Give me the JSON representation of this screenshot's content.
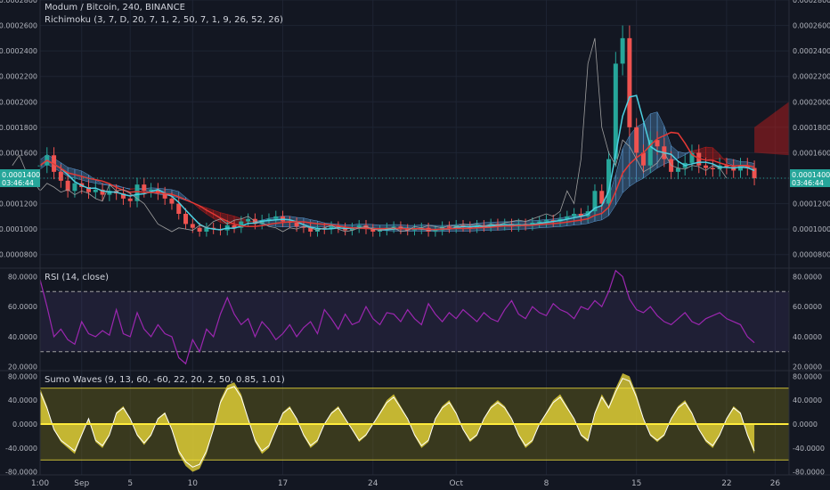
{
  "header": {
    "title": "Modum / Bitcoin, 240, BINANCE",
    "indicator": "Richimoku (3, 7, D, 20, 7, 1, 2, 50, 7, 1, 9, 26, 52, 26)"
  },
  "colors": {
    "background": "#131722",
    "grid": "#1e2433",
    "axis_text": "#b2b5be",
    "up_candle": "#26a69a",
    "down_candle": "#ef5350",
    "cloud_bull": "#5b9bd5",
    "cloud_bear": "#b71c1c",
    "rsi_line": "#9c27b0",
    "rsi_band": "#7e57c2",
    "sumo": "#ffeb3b",
    "price_badge": "#26a69a"
  },
  "price_badge": {
    "value": "0.0001400",
    "time": "03:46:44"
  },
  "chart_data": [
    {
      "type": "line",
      "panel": "price",
      "title": "Modum / Bitcoin, 240, BINANCE",
      "x_labels": [
        "1:00",
        "Sep",
        "5",
        "10",
        "17",
        "24",
        "Oct",
        "8",
        "15",
        "22",
        "26"
      ],
      "x_positions": [
        0,
        6,
        13,
        22,
        35,
        48,
        60,
        73,
        86,
        99,
        106
      ],
      "xlim": [
        0,
        108
      ],
      "yticks": [
        "0.0000800",
        "0.0001000",
        "0.0001200",
        "0.0001400",
        "0.0001600",
        "0.0001800",
        "0.0002000",
        "0.0002200",
        "0.0002400",
        "0.0002600",
        "0.0002800"
      ],
      "ylim": [
        7e-05,
        0.00028
      ],
      "close": [
        0.00015,
        0.000158,
        0.000145,
        0.000138,
        0.00013,
        0.000136,
        0.000133,
        0.000129,
        0.000131,
        0.000127,
        0.00013,
        0.000128,
        0.000124,
        0.000122,
        0.000135,
        0.00013,
        0.000131,
        0.000128,
        0.000124,
        0.00012,
        0.000112,
        0.000104,
        0.000101,
        9.8e-05,
        0.000101,
        0.0001,
        9.9e-05,
        0.000103,
        0.000101,
        0.000106,
        0.000108,
        0.000104,
        0.000107,
        0.000108,
        0.00011,
        0.000106,
        0.000105,
        0.000102,
        0.000101,
        9.8e-05,
        0.000101,
        0.0001,
        0.000102,
        0.000101,
        9.9e-05,
        0.000101,
        0.000103,
        0.0001,
        9.8e-05,
        9.9e-05,
        0.000101,
        0.000102,
        0.0001,
        9.9e-05,
        0.0001,
        0.000101,
        9.8e-05,
        9.9e-05,
        0.000102,
        0.000101,
        0.000103,
        0.000102,
        0.000101,
        0.000103,
        0.000102,
        0.000104,
        0.000103,
        0.000104,
        0.000102,
        0.000104,
        0.000103,
        0.000105,
        0.000106,
        0.000107,
        0.000106,
        0.000108,
        0.00011,
        0.000112,
        0.00011,
        0.000114,
        0.00013,
        0.00012,
        0.000155,
        0.00023,
        0.00025,
        0.00018,
        0.00016,
        0.00015,
        0.00017,
        0.000165,
        0.000155,
        0.000145,
        0.000148,
        0.000152,
        0.00016,
        0.00015,
        0.000148,
        0.000147,
        0.00015,
        0.000149,
        0.000146,
        0.00015,
        0.000148,
        0.00014
      ]
    },
    {
      "type": "line",
      "panel": "rsi",
      "title": "RSI (14, close)",
      "yticks": [
        "20.0000",
        "40.0000",
        "60.0000",
        "80.0000"
      ],
      "ylim": [
        18,
        85
      ],
      "bands": [
        30,
        70
      ],
      "values": [
        78,
        60,
        40,
        45,
        38,
        35,
        50,
        42,
        40,
        44,
        41,
        58,
        42,
        40,
        56,
        45,
        40,
        48,
        42,
        40,
        26,
        22,
        38,
        30,
        45,
        40,
        55,
        66,
        55,
        48,
        52,
        40,
        50,
        45,
        38,
        42,
        48,
        40,
        46,
        50,
        42,
        58,
        52,
        45,
        55,
        48,
        50,
        60,
        52,
        48,
        56,
        55,
        50,
        58,
        52,
        48,
        62,
        55,
        50,
        56,
        52,
        58,
        54,
        50,
        56,
        52,
        50,
        58,
        64,
        55,
        52,
        60,
        56,
        54,
        62,
        58,
        56,
        52,
        60,
        58,
        64,
        60,
        70,
        84,
        80,
        65,
        58,
        56,
        60,
        54,
        50,
        48,
        52,
        56,
        50,
        48,
        52,
        54,
        56,
        52,
        50,
        48,
        40,
        36
      ]
    },
    {
      "type": "area",
      "panel": "sumo",
      "title": "Sumo Waves (9, 13, 60, -60, 22, 20, 2, 50, 0.85, 1.01)",
      "yticks": [
        "-80.0000",
        "-40.0000",
        "0.0000",
        "40.0000",
        "80.0000"
      ],
      "ylim": [
        -85,
        88
      ],
      "levels": [
        60,
        -60
      ],
      "values": [
        60,
        30,
        -10,
        -30,
        -40,
        -50,
        -20,
        10,
        -30,
        -40,
        -20,
        20,
        30,
        10,
        -20,
        -35,
        -20,
        10,
        20,
        -10,
        -50,
        -70,
        -80,
        -75,
        -50,
        -10,
        40,
        65,
        70,
        50,
        10,
        -30,
        -50,
        -40,
        -10,
        20,
        30,
        10,
        -20,
        -40,
        -30,
        0,
        20,
        30,
        10,
        -10,
        -30,
        -20,
        0,
        20,
        40,
        50,
        30,
        10,
        -20,
        -40,
        -30,
        10,
        30,
        40,
        20,
        -10,
        -30,
        -20,
        10,
        30,
        40,
        30,
        10,
        -20,
        -40,
        -30,
        0,
        20,
        40,
        50,
        30,
        10,
        -20,
        -30,
        20,
        50,
        30,
        60,
        85,
        80,
        50,
        10,
        -20,
        -30,
        -20,
        10,
        30,
        40,
        20,
        -10,
        -30,
        -40,
        -20,
        10,
        30,
        20,
        -20,
        -50
      ]
    }
  ]
}
